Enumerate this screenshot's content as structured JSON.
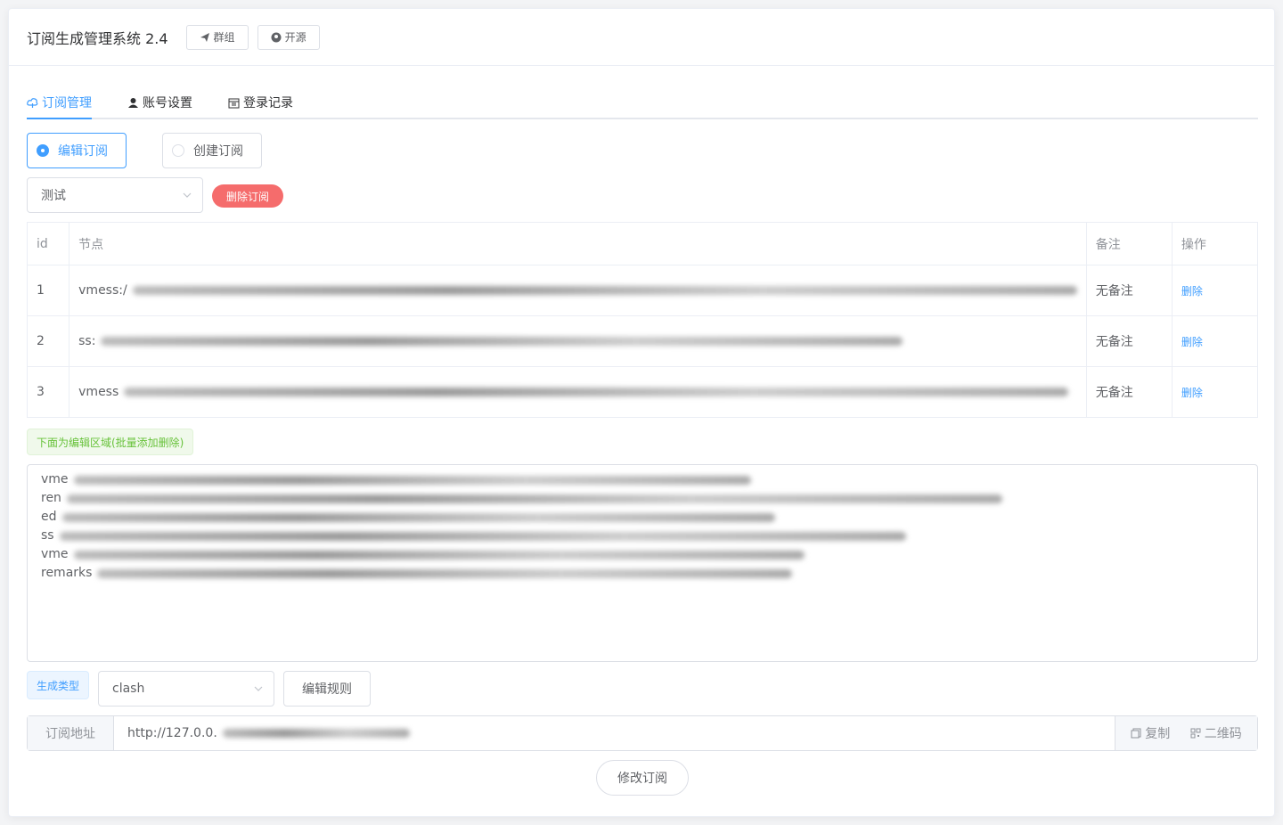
{
  "header": {
    "title": "订阅生成管理系统 2.4",
    "group_button": "群组",
    "opensource_button": "开源"
  },
  "tabs": [
    {
      "label": "订阅管理",
      "icon": "cloud-icon",
      "active": true
    },
    {
      "label": "账号设置",
      "icon": "user-icon",
      "active": false
    },
    {
      "label": "登录记录",
      "icon": "calendar-icon",
      "active": false
    }
  ],
  "mode": {
    "edit_label": "编辑订阅",
    "create_label": "创建订阅",
    "selected": "edit"
  },
  "subscription_select": {
    "value": "测试"
  },
  "delete_subscription_button": "删除订阅",
  "table": {
    "headers": [
      "id",
      "节点",
      "备注",
      "操作"
    ],
    "rows": [
      {
        "id": "1",
        "node": "vmess:/",
        "remark": "无备注",
        "action": "删除"
      },
      {
        "id": "2",
        "node": "ss:",
        "remark": "无备注",
        "action": "删除"
      },
      {
        "id": "3",
        "node": "vmess",
        "remark": "无备注",
        "action": "删除"
      }
    ]
  },
  "edit_area": {
    "info_tag": "下面为编辑区域(批量添加删除)",
    "lines": [
      "vme",
      "ren",
      "ed",
      "ss",
      "vme",
      "remarks"
    ]
  },
  "generate": {
    "type_tag": "生成类型",
    "type_value": "clash",
    "edit_rules_button": "编辑规则"
  },
  "url": {
    "label": "订阅地址",
    "value": "http://127.0.0.",
    "copy": "复制",
    "qrcode": "二维码"
  },
  "submit_button": "修改订阅",
  "colors": {
    "primary": "#409eff",
    "danger": "#f56c6c",
    "success": "#67c23a"
  }
}
